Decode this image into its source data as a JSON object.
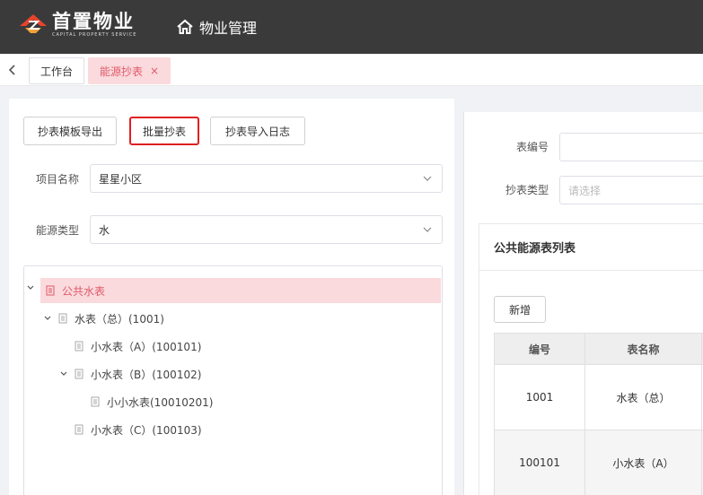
{
  "header": {
    "logo_cn": "首置物业",
    "logo_en": "CAPITAL PROPERTY SERVICE",
    "app_title": "物业管理",
    "bg": "#3a3a3a"
  },
  "tabs": [
    {
      "label": "工作台",
      "active": false
    },
    {
      "label": "能源抄表",
      "active": true,
      "close": "×"
    }
  ],
  "toolbar": {
    "export_template": "抄表模板导出",
    "batch_read": "批量抄表",
    "import_log": "抄表导入日志"
  },
  "form": {
    "project_label": "项目名称",
    "project_value": "星星小区",
    "energy_label": "能源类型",
    "energy_value": "水"
  },
  "tree": [
    {
      "label": "公共水表",
      "selected": true
    },
    {
      "label": "水表（总）(1001)"
    },
    {
      "label": "小水表（A）(100101)"
    },
    {
      "label": "小水表（B）(100102)"
    },
    {
      "label": "小小水表(10010201)"
    },
    {
      "label": "小水表（C）(100103)"
    }
  ],
  "right": {
    "meter_no_label": "表编号",
    "meter_no_value": "",
    "read_type_label": "抄表类型",
    "read_type_placeholder": "请选择",
    "card_title": "公共能源表列表",
    "add_label": "新增",
    "columns": [
      "编号",
      "表名称"
    ],
    "rows": [
      [
        "1001",
        "水表（总）"
      ],
      [
        "100101",
        "小水表（A）"
      ]
    ]
  },
  "colors": {
    "accent": "#e05a6a",
    "accent_bg": "#fadadd",
    "highlight_border": "#e02020"
  }
}
